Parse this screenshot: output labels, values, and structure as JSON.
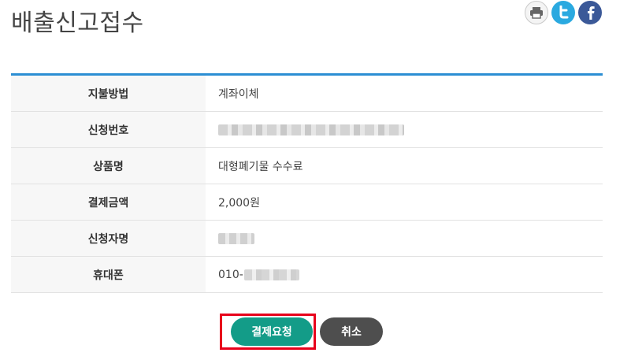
{
  "page": {
    "title": "배출신고접수"
  },
  "share": {
    "icons": [
      "print-icon",
      "twitter-icon",
      "facebook-icon"
    ],
    "colors": {
      "twitter": "#2aa9e0",
      "facebook": "#3b5998"
    }
  },
  "table": {
    "accent_color": "#2c8ed3",
    "rows": [
      {
        "label": "지불방법",
        "value": "계좌이체"
      },
      {
        "label": "신청번호",
        "value": ""
      },
      {
        "label": "상품명",
        "value": "대형폐기물 수수료"
      },
      {
        "label": "결제금액",
        "value": "2,000원"
      },
      {
        "label": "신청자명",
        "value": ""
      },
      {
        "label": "휴대폰",
        "value": "010-"
      }
    ]
  },
  "actions": {
    "pay_label": "결제요청",
    "cancel_label": "취소",
    "pay_color": "#139c88",
    "cancel_color": "#4e4e4e",
    "highlight_color": "#e8001b"
  }
}
